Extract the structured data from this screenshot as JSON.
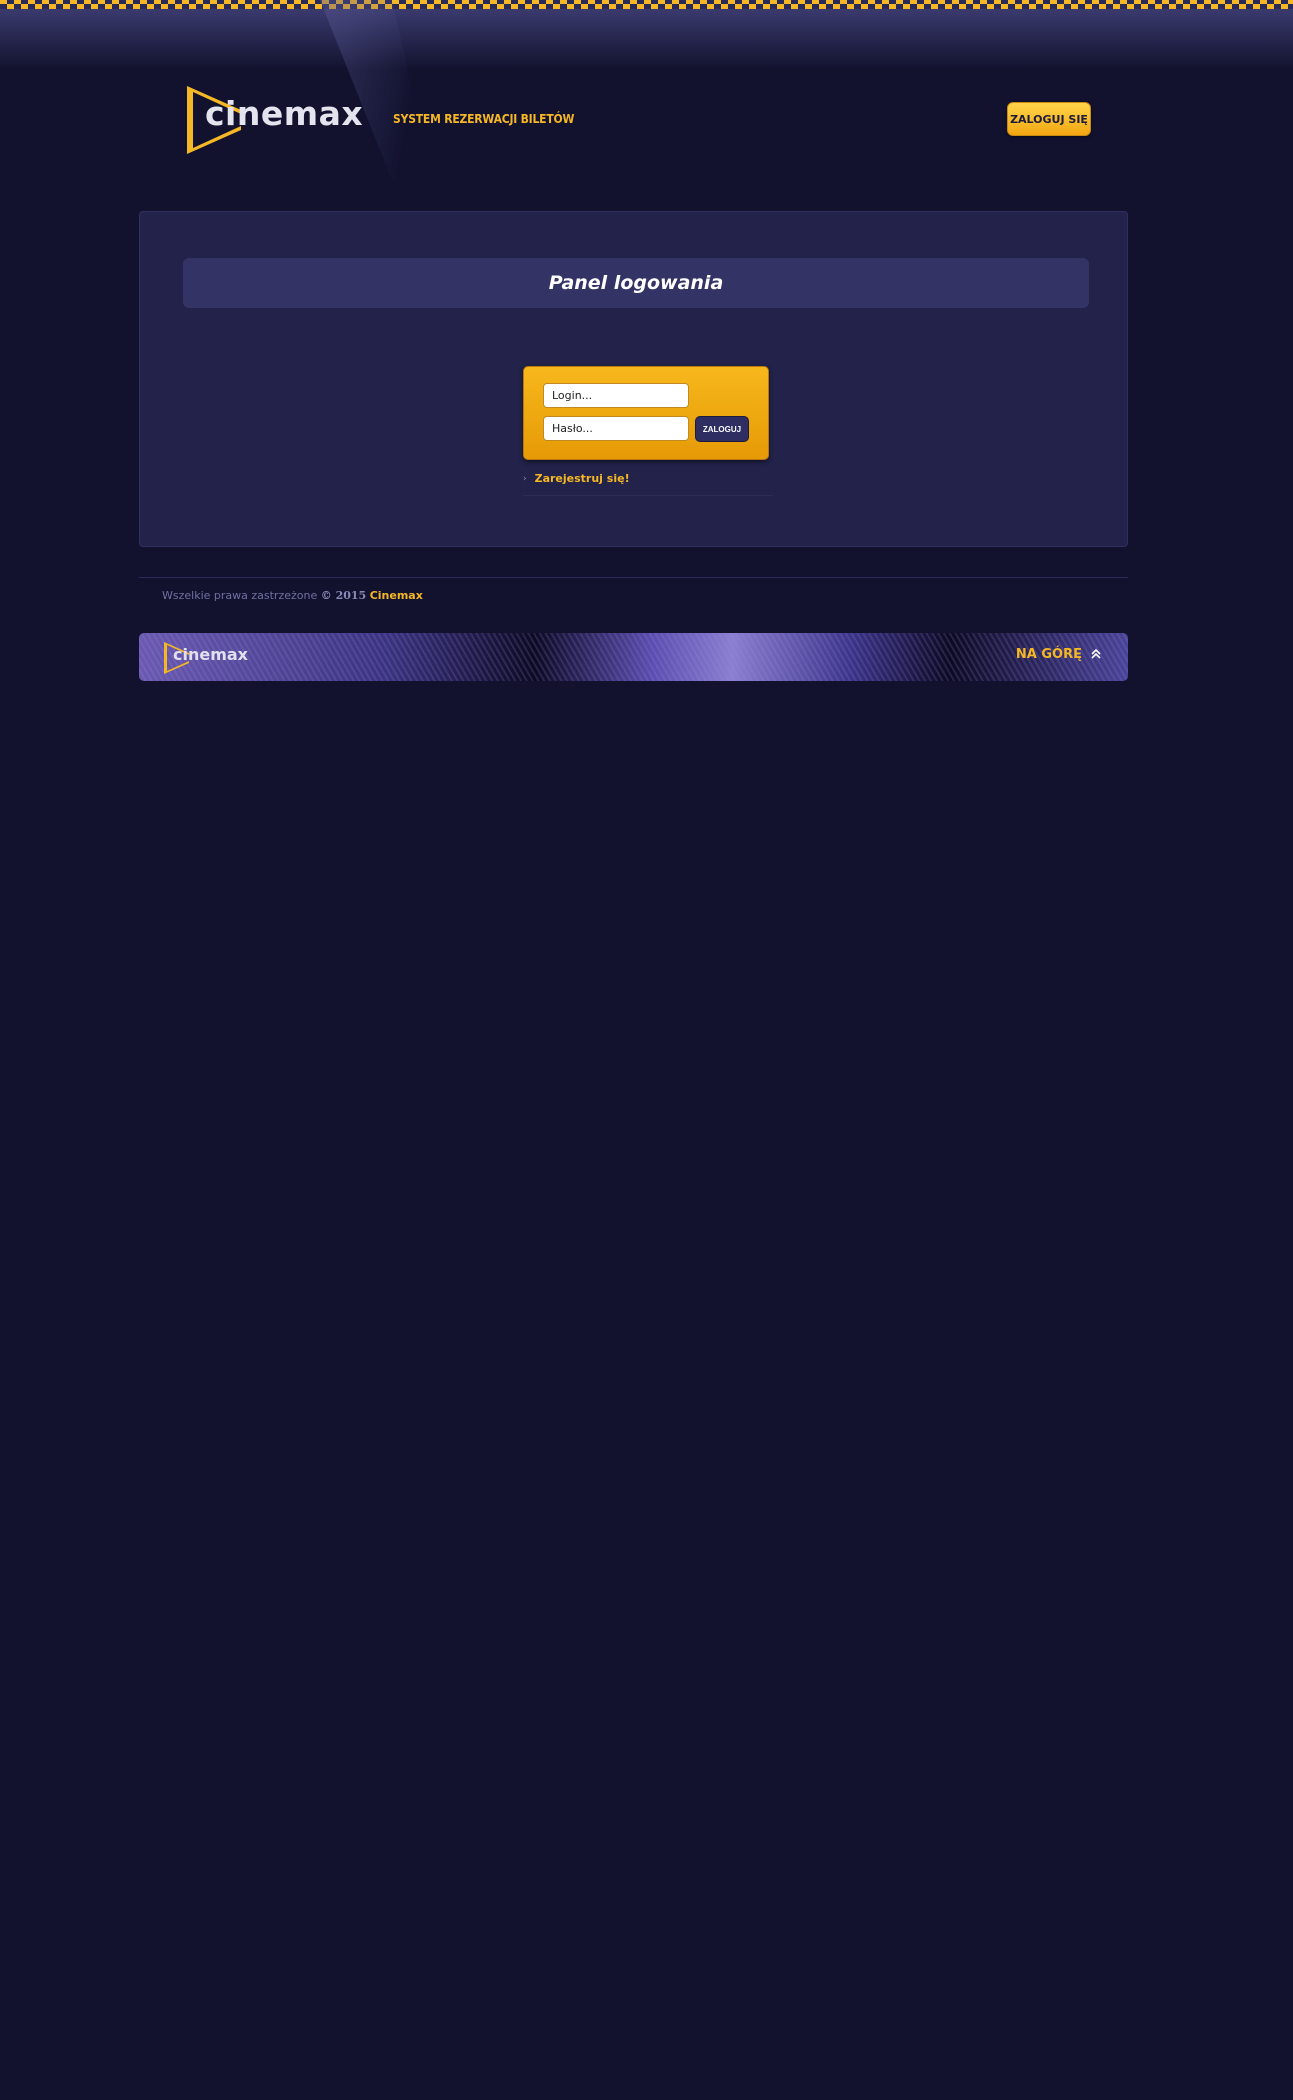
{
  "header": {
    "logo_text": "cinemax",
    "tagline": "SYSTEM REZERWACJI BILETÓW",
    "login_button": "ZALOGUJ SIĘ"
  },
  "login_panel": {
    "title": "Panel logowania",
    "login_placeholder": "Login...",
    "password_placeholder": "Hasło...",
    "submit_label": "ZALOGUJ",
    "register_link": "Zarejestruj się!"
  },
  "footer": {
    "copyright_text": "Wszelkie prawa zastrzeżone",
    "copyright_year": "© 2015",
    "brand": "Cinemax",
    "logo_text": "cinemax",
    "back_to_top": "NA GÓRĘ"
  },
  "colors": {
    "background": "#12122f",
    "panel": "#22224a",
    "accent": "#f5b724"
  }
}
